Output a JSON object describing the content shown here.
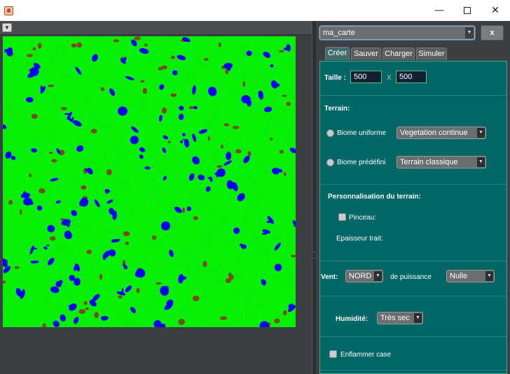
{
  "window": {
    "icon": "java-cup-icon",
    "minimize_glyph": "—",
    "close_glyph": "✕"
  },
  "left_toolbar": {
    "dropdown_glyph": "▼"
  },
  "map": {
    "background_color": "#05f005",
    "water_color": "#0000ff",
    "soil_color": "#7a4a20"
  },
  "map_selector": {
    "value": "ma_carte",
    "close_label": "x"
  },
  "tabs": [
    {
      "label": "Créer"
    },
    {
      "label": "Sauver"
    },
    {
      "label": "Charger"
    },
    {
      "label": "Simuler"
    }
  ],
  "size": {
    "label": "Taille :",
    "width": "500",
    "separator": "X",
    "height": "500"
  },
  "terrain": {
    "title": "Terrain:",
    "uniform_label": "Biome uniforme",
    "uniform_value": "Vegetation continue",
    "predefined_label": "Biome prédéfini",
    "predefined_value": "Terrain classique"
  },
  "custom": {
    "title": "Personnalisation du terrain:",
    "brush_label": "Pinceau:",
    "stroke_label": "Epaisseur trait:"
  },
  "wind": {
    "label": "Vent:",
    "direction": "NORD",
    "strength_label": "de puissance",
    "strength": "Nulle"
  },
  "humidity": {
    "label": "Humidité:",
    "value": "Très sec"
  },
  "ignite": {
    "label": "Enflammer case"
  }
}
